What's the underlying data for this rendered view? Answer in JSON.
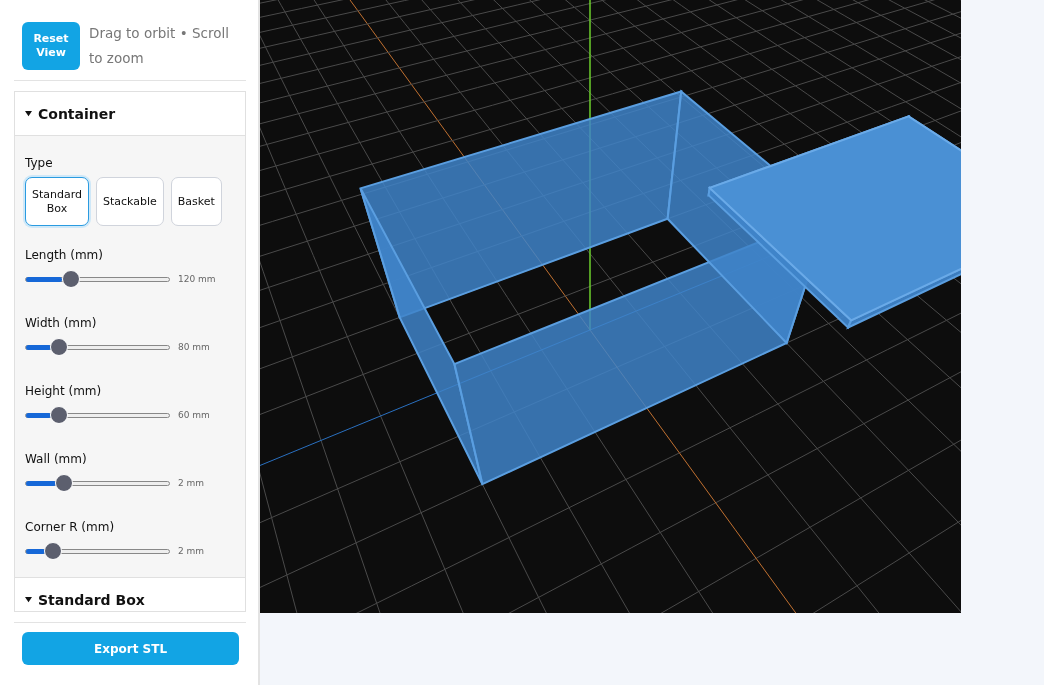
{
  "toolbar": {
    "reset_button": "Reset View",
    "hint": "Drag to orbit • Scroll to zoom"
  },
  "sections": [
    {
      "title": "Container",
      "expanded": true,
      "type_label": "Type",
      "types": [
        {
          "label": "Standard Box",
          "selected": true
        },
        {
          "label": "Stackable",
          "selected": false
        },
        {
          "label": "Basket",
          "selected": false
        }
      ],
      "sliders": [
        {
          "label": "Length (mm)",
          "level": 0.29,
          "reading": "120 mm"
        },
        {
          "label": "Width (mm)",
          "level": 0.2,
          "reading": "80 mm"
        },
        {
          "label": "Height (mm)",
          "level": 0.2,
          "reading": "60 mm"
        },
        {
          "label": "Wall (mm)",
          "level": 0.24,
          "reading": "2 mm"
        },
        {
          "label": "Corner R (mm)",
          "level": 0.15,
          "reading": "2 mm"
        }
      ]
    },
    {
      "title": "Standard Box",
      "expanded": true
    }
  ],
  "export_button": "Export STL"
}
